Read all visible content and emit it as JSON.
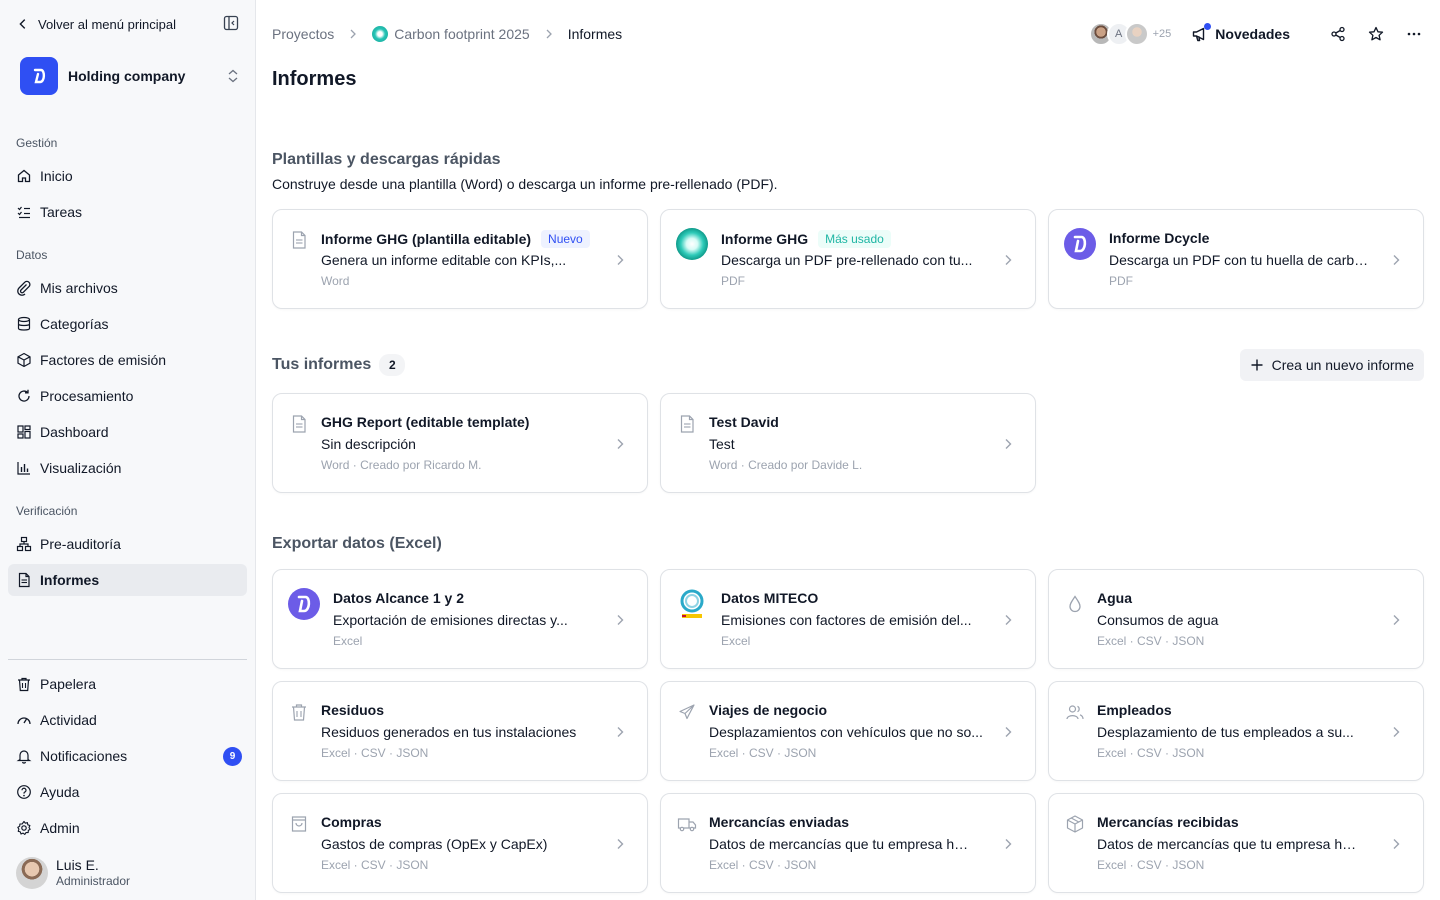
{
  "sidebar": {
    "back_label": "Volver al menú principal",
    "company": "Holding company",
    "sections": {
      "gestion": "Gestión",
      "datos": "Datos",
      "verificacion": "Verificación"
    },
    "items": {
      "inicio": "Inicio",
      "tareas": "Tareas",
      "archivos": "Mis archivos",
      "categorias": "Categorías",
      "factores": "Factores de emisión",
      "procesamiento": "Procesamiento",
      "dashboard": "Dashboard",
      "visualizacion": "Visualización",
      "preauditoria": "Pre-auditoría",
      "informes": "Informes",
      "papelera": "Papelera",
      "actividad": "Actividad",
      "notificaciones": "Notificaciones",
      "ayuda": "Ayuda",
      "admin": "Admin"
    },
    "notifications_count": "9",
    "user": {
      "name": "Luis E.",
      "role": "Administrador"
    }
  },
  "header": {
    "breadcrumb": [
      "Proyectos",
      "Carbon footprint 2025",
      "Informes"
    ],
    "avatar_initial": "A",
    "avatar_more": "+25",
    "news_label": "Novedades"
  },
  "page": {
    "title": "Informes",
    "templates_title": "Plantillas y descargas rápidas",
    "templates_subtitle": "Construye desde una plantilla (Word) o descarga un informe pre-rellenado (PDF).",
    "your_reports_title": "Tus informes",
    "your_reports_count": "2",
    "new_report_label": "Crea un nuevo informe",
    "export_title": "Exportar datos (Excel)"
  },
  "templates": [
    {
      "title": "Informe GHG (plantilla editable)",
      "tag": "Nuevo",
      "desc": "Genera un informe editable con KPIs,...",
      "meta": "Word"
    },
    {
      "title": "Informe GHG",
      "tag": "Más usado",
      "desc": "Descarga un PDF pre-rellenado con tu...",
      "meta": "PDF"
    },
    {
      "title": "Informe Dcycle",
      "desc": "Descarga un PDF con tu huella de carbo...",
      "meta": "PDF"
    }
  ],
  "reports": [
    {
      "title": "GHG Report (editable template)",
      "desc": "Sin descripción",
      "meta": "Word · Creado por Ricardo M."
    },
    {
      "title": "Test David",
      "desc": "Test",
      "meta": "Word · Creado por Davide L."
    }
  ],
  "exports": [
    {
      "title": "Datos Alcance 1 y 2",
      "desc": "Exportación de emisiones directas y...",
      "meta": "Excel"
    },
    {
      "title": "Datos MITECO",
      "desc": "Emisiones con factores de emisión del...",
      "meta": "Excel"
    },
    {
      "title": "Agua",
      "desc": "Consumos de agua",
      "meta": "Excel · CSV · JSON"
    },
    {
      "title": "Residuos",
      "desc": "Residuos generados en tus instalaciones",
      "meta": "Excel · CSV · JSON"
    },
    {
      "title": "Viajes de negocio",
      "desc": "Desplazamientos con vehículos que no so...",
      "meta": "Excel · CSV · JSON"
    },
    {
      "title": "Empleados",
      "desc": "Desplazamiento de tus empleados a su...",
      "meta": "Excel · CSV · JSON"
    },
    {
      "title": "Compras",
      "desc": "Gastos de compras (OpEx y CapEx)",
      "meta": "Excel · CSV · JSON"
    },
    {
      "title": "Mercancías enviadas",
      "desc": "Datos de mercancías que tu empresa ha...",
      "meta": "Excel · CSV · JSON"
    },
    {
      "title": "Mercancías recibidas",
      "desc": "Datos de mercancías que tu empresa ha...",
      "meta": "Excel · CSV · JSON"
    }
  ],
  "colors": {
    "accent": "#2f4ff3",
    "teal": "#1fb6a4",
    "dcycle": "#6c5ce7"
  }
}
